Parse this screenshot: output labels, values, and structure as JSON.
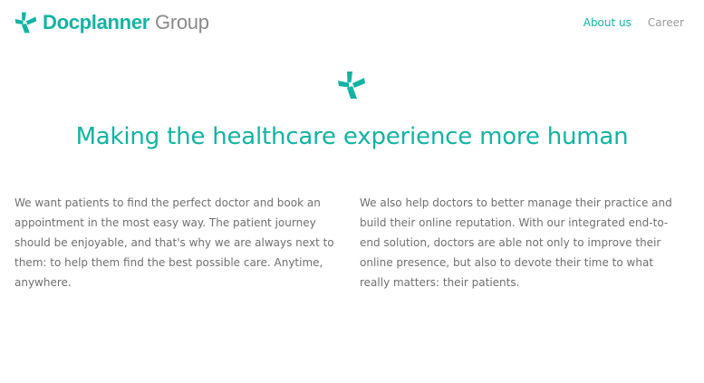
{
  "brand": {
    "name_primary": "Docplanner",
    "name_secondary": "Group",
    "accent_color": "#12b3a2",
    "secondary_color": "#8a8a8a",
    "logo_icon": "docplanner-asterisk-icon"
  },
  "nav": {
    "items": [
      {
        "label": "About us",
        "active": true
      },
      {
        "label": "Career",
        "active": false
      }
    ]
  },
  "hero": {
    "icon": "docplanner-asterisk-icon",
    "headline": "Making the healthcare experience more human"
  },
  "content": {
    "left_paragraph": "We want patients to find the perfect doctor and book an appointment in the most easy way. The patient journey should be enjoyable, and that's why we are always next to them: to help them find the best possible care. Anytime, anywhere.",
    "right_paragraph": "We also help doctors to better manage their practice and build their online reputation. With our integrated end-to-end solution, doctors are able not only to improve their online presence, but also to devote their time to what really matters: their patients."
  }
}
